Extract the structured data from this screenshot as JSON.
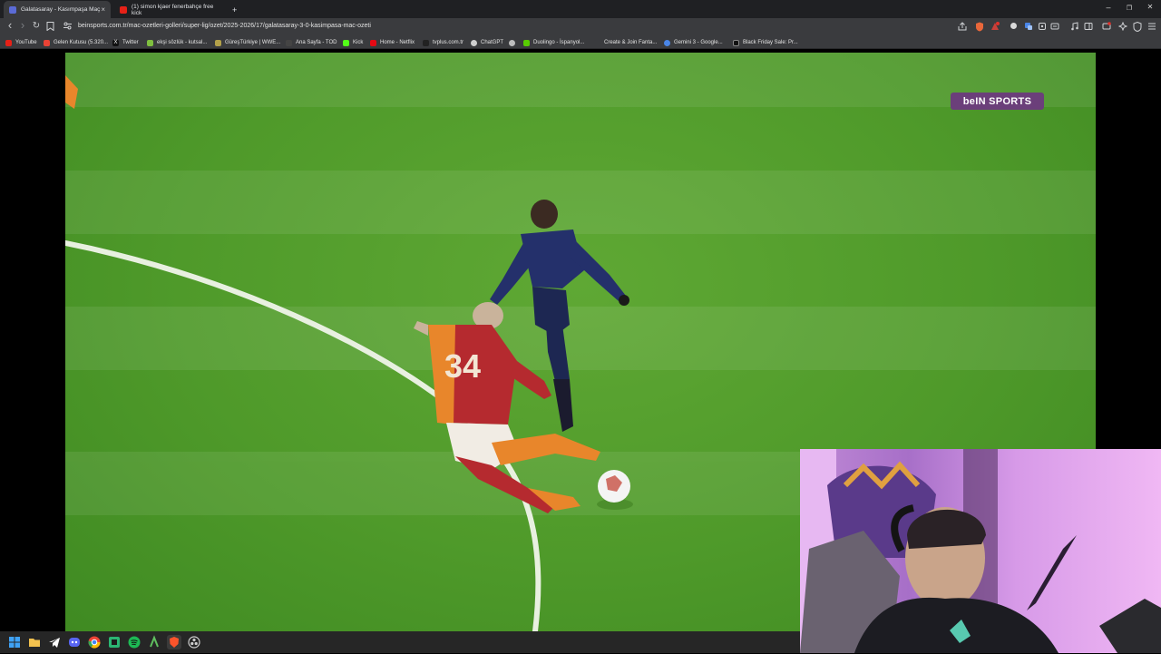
{
  "tabs": [
    {
      "title": "Galatasaray - Kasımpaşa Maç",
      "active": true,
      "close": "×"
    },
    {
      "title": "(1) simon kjaer fenerbahçe free kick",
      "active": false
    }
  ],
  "new_tab": "+",
  "window_controls": {
    "minimize": "–",
    "restore": "❐",
    "close": "✕"
  },
  "nav": {
    "back": "‹",
    "forward": "›",
    "reload": "↻"
  },
  "address": {
    "url": "beinsports.com.tr/mac-ozetleri-golleri/super-lig/ozet/2025-2026/17/galatasaray-3-0-kasimpasa-mac-ozeti"
  },
  "bookmarks": [
    "YouTube",
    "Gelen Kutusu (5.320...",
    "Twitter",
    "ekşi sözlük - kutsal...",
    "GüreşTürkiye | WWE...",
    "Ana Sayfa - TOD",
    "Kick",
    "Home - Netflix",
    "tvplus.com.tr",
    "ChatGPT",
    "",
    "Duolingo - İspanyol...",
    "Create & Join Fanta...",
    "Gemini 3 - Google...",
    "Black Friday Sale: Pr..."
  ],
  "video": {
    "channel_logo": "beIN SPORTS",
    "player_number": "34"
  },
  "colors": {
    "pitch": "#4f9a2a",
    "channel_logo_bg": "#6b3f7a",
    "galatasaray_red": "#b52a2f",
    "galatasaray_orange": "#e8862b",
    "opponent_navy": "#24306b"
  }
}
